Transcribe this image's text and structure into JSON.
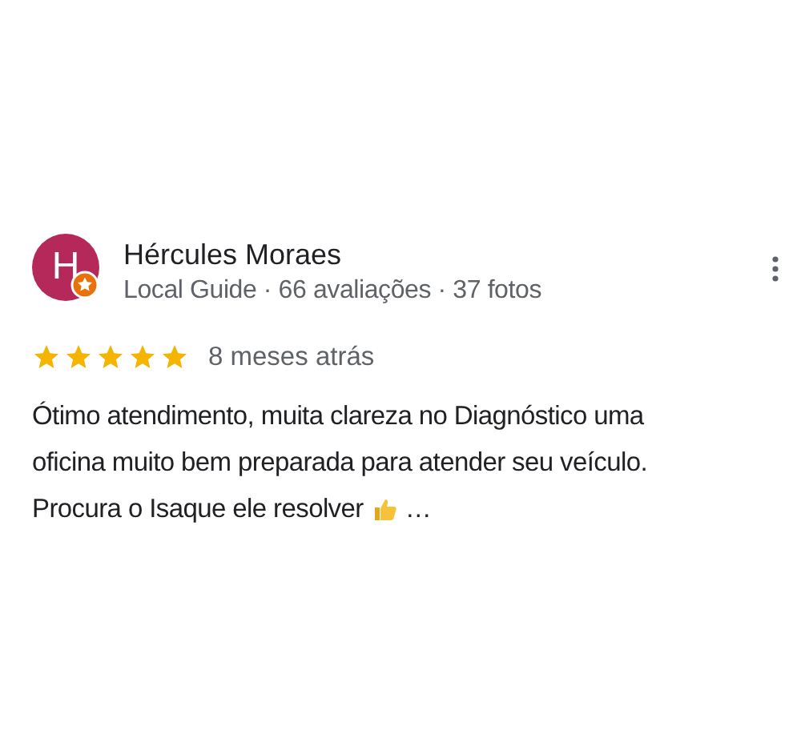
{
  "review": {
    "avatar_letter": "H",
    "local_guide_badge": true,
    "author": "Hércules Moraes",
    "meta": "Local Guide · 66 avaliações · 37 fotos",
    "stars": 5,
    "time": "8 meses atrás",
    "text_lines": [
      "Ótimo atendimento, muita clareza no Diagnóstico uma",
      "oficina muito bem preparada para atender seu veículo.",
      "Procura o Isaque ele resolver"
    ],
    "ellipsis": "…"
  }
}
